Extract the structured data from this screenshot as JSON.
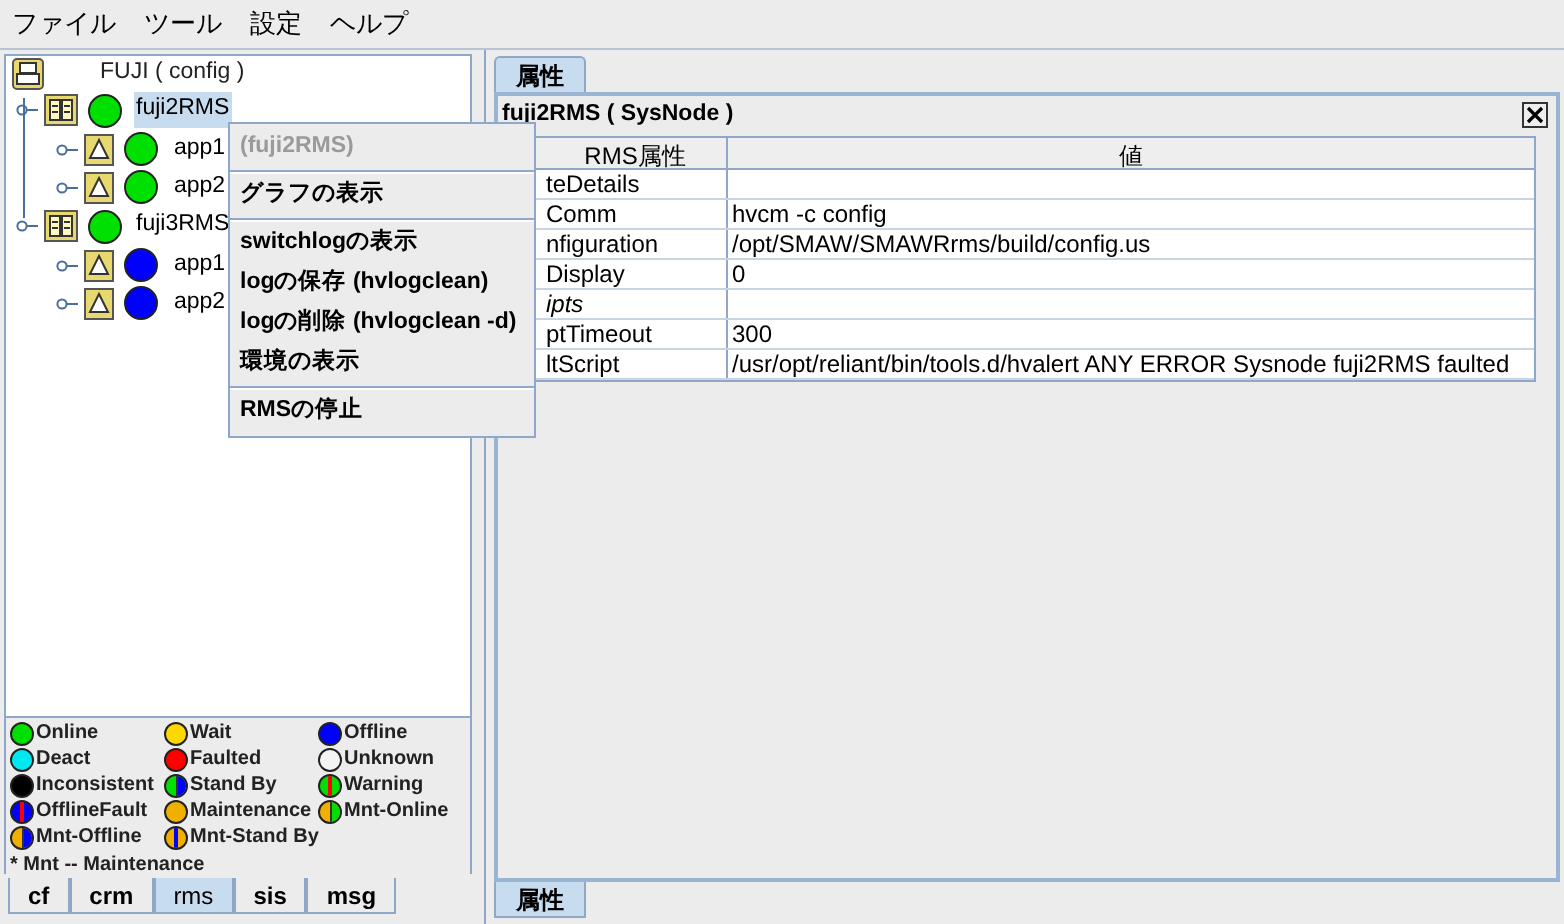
{
  "menu_bar": [
    "ファイル",
    "ツール",
    "設定",
    "ヘルプ"
  ],
  "tree": {
    "label": "FUJI ( config )",
    "kind": "root",
    "children": [
      {
        "label": "fuji2RMS",
        "kind": "sysnode",
        "color": "#00e000",
        "selected": true,
        "children": [
          {
            "label": "app1",
            "kind": "app",
            "color": "#00e000",
            "selected": false
          },
          {
            "label": "app2",
            "kind": "app",
            "color": "#00e000",
            "selected": false
          }
        ]
      },
      {
        "label": "fuji3RMS",
        "kind": "sysnode",
        "color": "#00e000",
        "selected": false,
        "children": [
          {
            "label": "app1",
            "kind": "app",
            "color": "#0000ff",
            "selected": false
          },
          {
            "label": "app2",
            "kind": "app",
            "color": "#0000ff",
            "selected": false
          }
        ]
      }
    ]
  },
  "context_menu": [
    {
      "label": "(fuji2RMS)",
      "disabled": true,
      "separator_after": true
    },
    {
      "label": "グラフの表示",
      "disabled": false,
      "separator_after": true
    },
    {
      "label": "switchlogの表示",
      "disabled": false,
      "separator_after": false
    },
    {
      "label": "logの保存 (hvlogclean)",
      "disabled": false,
      "separator_after": false
    },
    {
      "label": "logの削除 (hvlogclean -d)",
      "disabled": false,
      "separator_after": false
    },
    {
      "label": "環境の表示",
      "disabled": false,
      "separator_after": true
    },
    {
      "label": "RMSの停止",
      "disabled": false,
      "separator_after": false
    }
  ],
  "legend": [
    {
      "label": "Online",
      "kind": "solid",
      "color": "#00e000"
    },
    {
      "label": "Wait",
      "kind": "solid",
      "color": "#ffd800"
    },
    {
      "label": "Offline",
      "kind": "solid",
      "color": "#0000ff"
    },
    {
      "label": "Deact",
      "kind": "solid",
      "color": "#00e8f0"
    },
    {
      "label": "Faulted",
      "kind": "solid",
      "color": "#ff0000"
    },
    {
      "label": "Unknown",
      "kind": "solid",
      "color": "#f4f4f4"
    },
    {
      "label": "Inconsistent",
      "kind": "solid",
      "color": "#000000"
    },
    {
      "label": "Stand By",
      "kind": "split",
      "color": "#00e000",
      "second": {
        "color": "#0000ff"
      }
    },
    {
      "label": "Warning",
      "kind": "stripe",
      "color": "#00e000",
      "second": {
        "color": "#ff0000"
      }
    },
    {
      "label": "OfflineFault",
      "kind": "stripe",
      "color": "#0000ff",
      "second": {
        "color": "#ff0000"
      }
    },
    {
      "label": "Maintenance",
      "kind": "solid",
      "color": "#f0b000"
    },
    {
      "label": "Mnt-Online",
      "kind": "split",
      "color": "#f0b000",
      "second": {
        "color": "#00e000"
      }
    },
    {
      "label": "Mnt-Offline",
      "kind": "split",
      "color": "#f0b000",
      "second": {
        "color": "#0000ff"
      }
    },
    {
      "label": "Mnt-Stand By",
      "kind": "stripe",
      "color": "#f0b000",
      "second": {
        "color": "#0000ff"
      }
    }
  ],
  "legend_note": "* Mnt -- Maintenance",
  "left_tabs": [
    {
      "label": "cf",
      "selected": false
    },
    {
      "label": "crm",
      "selected": false
    },
    {
      "label": "rms",
      "selected": true
    },
    {
      "label": "sis",
      "selected": false
    },
    {
      "label": "msg",
      "selected": false
    }
  ],
  "top_tab": "属性",
  "panel_title": "fuji2RMS ( SysNode )",
  "table": {
    "columns": [
      "RMS属性",
      "値"
    ],
    "rows": [
      {
        "attribute": "teDetails",
        "italic": false
      },
      {
        "attribute": "Comm",
        "value": "hvcm -c config",
        "italic": false
      },
      {
        "attribute": "nfiguration",
        "value": "/opt/SMAW/SMAWRrms/build/config.us",
        "italic": false
      },
      {
        "attribute": "Display",
        "value": "0",
        "italic": false
      },
      {
        "attribute": "ipts",
        "italic": true
      },
      {
        "attribute": "ptTimeout",
        "value": "300",
        "italic": false
      },
      {
        "attribute": "ltScript",
        "value": "/usr/opt/reliant/bin/tools.d/hvalert ANY ERROR Sysnode fuji2RMS faulted",
        "italic": false
      }
    ]
  },
  "bottom_tab": "属性"
}
